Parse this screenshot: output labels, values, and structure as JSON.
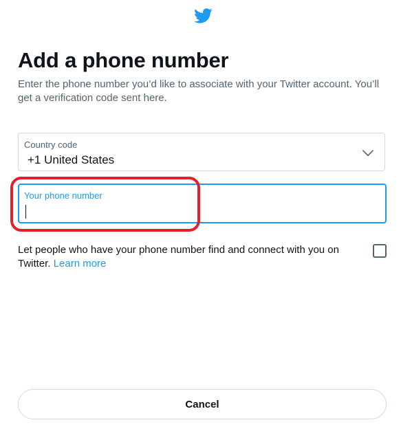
{
  "header": {
    "logo_icon": "twitter-bird-icon",
    "title": "Add a phone number",
    "subtitle": "Enter the phone number you’d like to associate with your Twitter account. You’ll get a verification code sent here."
  },
  "country_code": {
    "label": "Country code",
    "value": "+1 United States",
    "icon": "chevron-down-icon"
  },
  "phone_number": {
    "label": "Your phone number",
    "value": "",
    "focused": true
  },
  "discoverability": {
    "text": "Let people who have your phone number find and connect with you on Twitter.",
    "link": "Learn more",
    "checked": false
  },
  "footer": {
    "cancel_label": "Cancel"
  },
  "colors": {
    "accent": "#1d9bf0",
    "text": "#0f1419",
    "secondary_text": "#536471",
    "border": "#cfd9de",
    "annotation": "#e0202a"
  }
}
